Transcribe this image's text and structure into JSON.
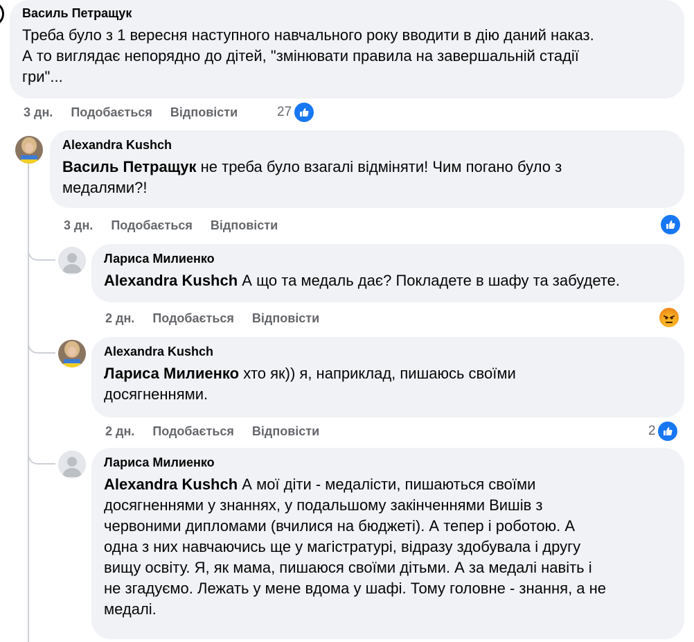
{
  "comments": [
    {
      "author": "Василь Петращук",
      "mention": "",
      "text_lines": [
        "Треба було з 1 вересня наступного навчального року вводити в дію даний наказ.",
        "А то виглядає непорядно до дітей, \"змінювати правила на завершальній стадії",
        "гри\"..."
      ],
      "time": "3 дн.",
      "like_label": "Подобається",
      "reply_label": "Відповісти",
      "reaction_count": "27",
      "reaction": "like-icon"
    },
    {
      "author": "Alexandra Kushch",
      "mention": "Василь Петращук",
      "text_first": " не треба було взагалі відміняти! Чим погано було з",
      "text_rest": "медалями?!",
      "time": "3 дн.",
      "like_label": "Подобається",
      "reply_label": "Відповісти",
      "reaction_count": "",
      "reaction": "like-icon"
    },
    {
      "author": "Лариса Милиенко",
      "mention": "Alexandra Kushch",
      "text_first": " А що та медаль дає? Покладете в шафу та забудете.",
      "time": "2 дн.",
      "like_label": "Подобається",
      "reply_label": "Відповісти",
      "reaction_count": "",
      "reaction": "angry-icon"
    },
    {
      "author": "Alexandra Kushch",
      "mention": "Лариса Милиенко",
      "text_first": " хто як)) я, наприклад, пишаюсь своїми",
      "text_rest": "досягненнями.",
      "time": "2 дн.",
      "like_label": "Подобається",
      "reply_label": "Відповісти",
      "reaction_count": "2",
      "reaction": "like-icon"
    },
    {
      "author": "Лариса Милиенко",
      "mention": "Alexandra Kushch",
      "text_first": " А мої діти - медалісти, пишаються своїми",
      "text_lines": [
        "досягненнями у знаннях, у подальшому закінченнями Вишів з",
        "червоними дипломами (вчилися на бюджеті). А тепер і роботою. А",
        "одна з них навчаючись ще у магістратурі, відразу здобувала і другу",
        "вищу освіту. Я, як мама, пишаюся своїми дітьми. А за медалі навіть і",
        "не згадуємо. Лежать у мене вдома у шафі. Тому головне - знання, а не",
        "медалі."
      ]
    }
  ],
  "colors": {
    "bubble": "#f0f2f5",
    "meta_text": "#65676b",
    "like_blue": "#1877f2",
    "angry_orange": "#e9710f"
  }
}
